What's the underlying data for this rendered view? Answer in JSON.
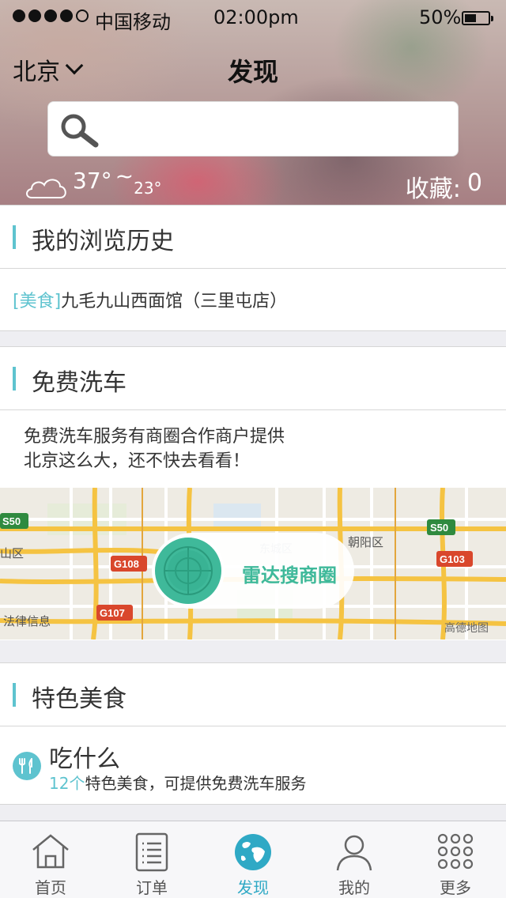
{
  "status": {
    "carrier": "中国移动",
    "time": "02:00pm",
    "battery": "50%",
    "signal_bars_filled": 4,
    "signal_bars_total": 5
  },
  "header": {
    "city": "北京",
    "title": "发现",
    "search_placeholder": "",
    "weather": {
      "high": "37°",
      "separator": "~",
      "low": "23°"
    },
    "favorites_label": "收藏:",
    "favorites_count": "0"
  },
  "history": {
    "title": "我的浏览历史",
    "item": {
      "tag": "[美食]",
      "name": "九毛九山西面馆（三里屯店）"
    }
  },
  "car_wash": {
    "title": "免费洗车",
    "desc_line1": "免费洗车服务有商圈合作商户提供",
    "desc_line2": "北京这么大，还不快去看看！",
    "map": {
      "radar_label": "雷达搜商圈",
      "labels": [
        "S50",
        "S50",
        "G108",
        "G107",
        "G103",
        "朝阳区",
        "法律信息",
        "高德地图",
        "山区",
        "东城区"
      ]
    }
  },
  "food": {
    "title": "特色美食",
    "item_title": "吃什么",
    "count": "12个",
    "desc": "特色美食，可提供免费洗车服务"
  },
  "tabbar": {
    "tabs": [
      {
        "label": "首页",
        "icon": "home-icon"
      },
      {
        "label": "订单",
        "icon": "order-list-icon"
      },
      {
        "label": "发现",
        "icon": "globe-icon"
      },
      {
        "label": "我的",
        "icon": "user-icon"
      },
      {
        "label": "更多",
        "icon": "grid-dots-icon"
      }
    ],
    "active": "发现"
  },
  "colors": {
    "accent": "#5ec3cf",
    "radar": "#3fb99a",
    "active_tab": "#2fa9c5"
  }
}
